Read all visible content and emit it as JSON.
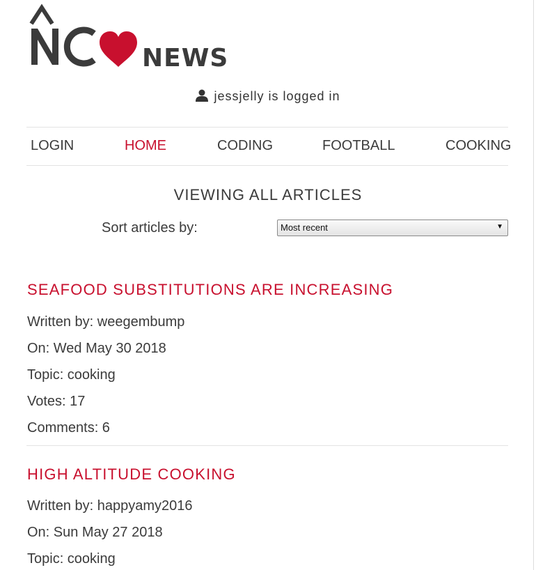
{
  "logo": {
    "letters": "NC",
    "word": "NEWS",
    "heart_color": "#c8102e",
    "text_color": "#3b3b3b"
  },
  "user_status": {
    "icon": "user-icon",
    "text": "jessjelly is logged in"
  },
  "nav": {
    "items": [
      {
        "label": "LOGIN",
        "active": false
      },
      {
        "label": "HOME",
        "active": true
      },
      {
        "label": "CODING",
        "active": false
      },
      {
        "label": "FOOTBALL",
        "active": false
      },
      {
        "label": "COOKING",
        "active": false
      }
    ]
  },
  "main": {
    "heading": "VIEWING ALL ARTICLES",
    "sort": {
      "label": "Sort articles by:",
      "selected": "Most recent"
    }
  },
  "articles": [
    {
      "title": "SEAFOOD SUBSTITUTIONS ARE INCREASING",
      "author": "Written by: weegembump",
      "date": "On: Wed May 30 2018",
      "topic": "Topic: cooking",
      "votes": "Votes: 17",
      "comments": "Comments: 6"
    },
    {
      "title": "HIGH ALTITUDE COOKING",
      "author": "Written by: happyamy2016",
      "date": "On: Sun May 27 2018",
      "topic": "Topic: cooking"
    }
  ],
  "colors": {
    "accent": "#c8102e",
    "text": "#3b3b3b",
    "divider": "#e3e3e3"
  }
}
